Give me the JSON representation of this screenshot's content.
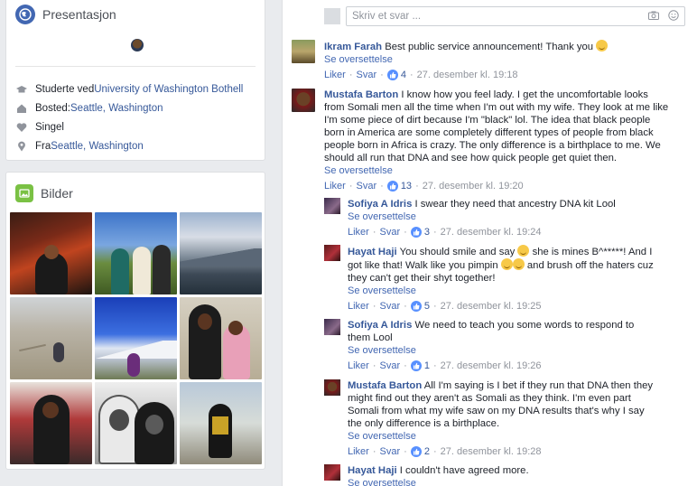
{
  "intro": {
    "title": "Presentasjon",
    "rows": [
      {
        "icon": "education-icon",
        "prefix": "Studerte ved ",
        "link": "University of Washington Bothell",
        "link2": ""
      },
      {
        "icon": "home-icon",
        "prefix": "Bosted: ",
        "link": "Seattle, Washington",
        "link2": ""
      },
      {
        "icon": "heart-icon",
        "prefix": "Singel",
        "link": "",
        "link2": ""
      },
      {
        "icon": "location-pin-icon",
        "prefix": "Fra ",
        "link": "Seattle, Washington",
        "link2": ""
      }
    ]
  },
  "photos": {
    "title": "Bilder"
  },
  "composer": {
    "placeholder": "Skriv et svar ..."
  },
  "comments": [
    {
      "name": "Ikram Farah",
      "text": "Best public service announcement! Thank you",
      "emoji": true,
      "see": "Se oversettelse",
      "like": "Liker",
      "reply": "Svar",
      "count": "4",
      "time": "27. desember kl. 19:18"
    },
    {
      "name": "Mustafa Barton",
      "text": "I know how you feel lady. I get the uncomfortable looks from Somali men all the time when I'm out with my wife. They look at me like I'm some piece of dirt because I'm \"black\" lol. The idea that black people born in America are some completely different types of people from black people born in Africa is crazy. The only difference is a birthplace to me. We should all run that DNA and see how quick people get quiet then.",
      "see": "Se oversettelse",
      "like": "Liker",
      "reply": "Svar",
      "count": "13",
      "time": "27. desember kl. 19:20"
    }
  ],
  "replies": [
    {
      "name": "Sofiya A Idris",
      "text": "I swear they need that ancestry DNA kit Lool",
      "see": "Se oversettelse",
      "like": "Liker",
      "reply": "Svar",
      "count": "3",
      "time": "27. desember kl. 19:24"
    },
    {
      "name": "Hayat Haji",
      "text_a": "You should smile and say",
      "text_b": "she is mines B^*****! And I got like that! Walk like you pimpin",
      "text_c": "and brush off the haters cuz they can't get their shyt together!",
      "see": "Se oversettelse",
      "like": "Liker",
      "reply": "Svar",
      "count": "5",
      "time": "27. desember kl. 19:25"
    },
    {
      "name": "Sofiya A Idris",
      "text": "We need to teach you some words to respond to them Lool",
      "see": "Se oversettelse",
      "like": "Liker",
      "reply": "Svar",
      "count": "1",
      "time": "27. desember kl. 19:26"
    },
    {
      "name": "Mustafa Barton",
      "text": "All I'm saying is I bet if they run that DNA then they might find out they aren't as Somali as they think. I'm even part Somali from what my wife saw on my DNA results that's why I say the only difference is a birthplace.",
      "see": "Se oversettelse",
      "like": "Liker",
      "reply": "Svar",
      "count": "2",
      "time": "27. desember kl. 19:28"
    },
    {
      "name": "Hayat Haji",
      "text": "I couldn't have agreed more.",
      "see": "Se oversettelse"
    }
  ],
  "colors": {
    "link": "#365899",
    "accent": "#4267b2",
    "like_badge": "#5890ff"
  }
}
